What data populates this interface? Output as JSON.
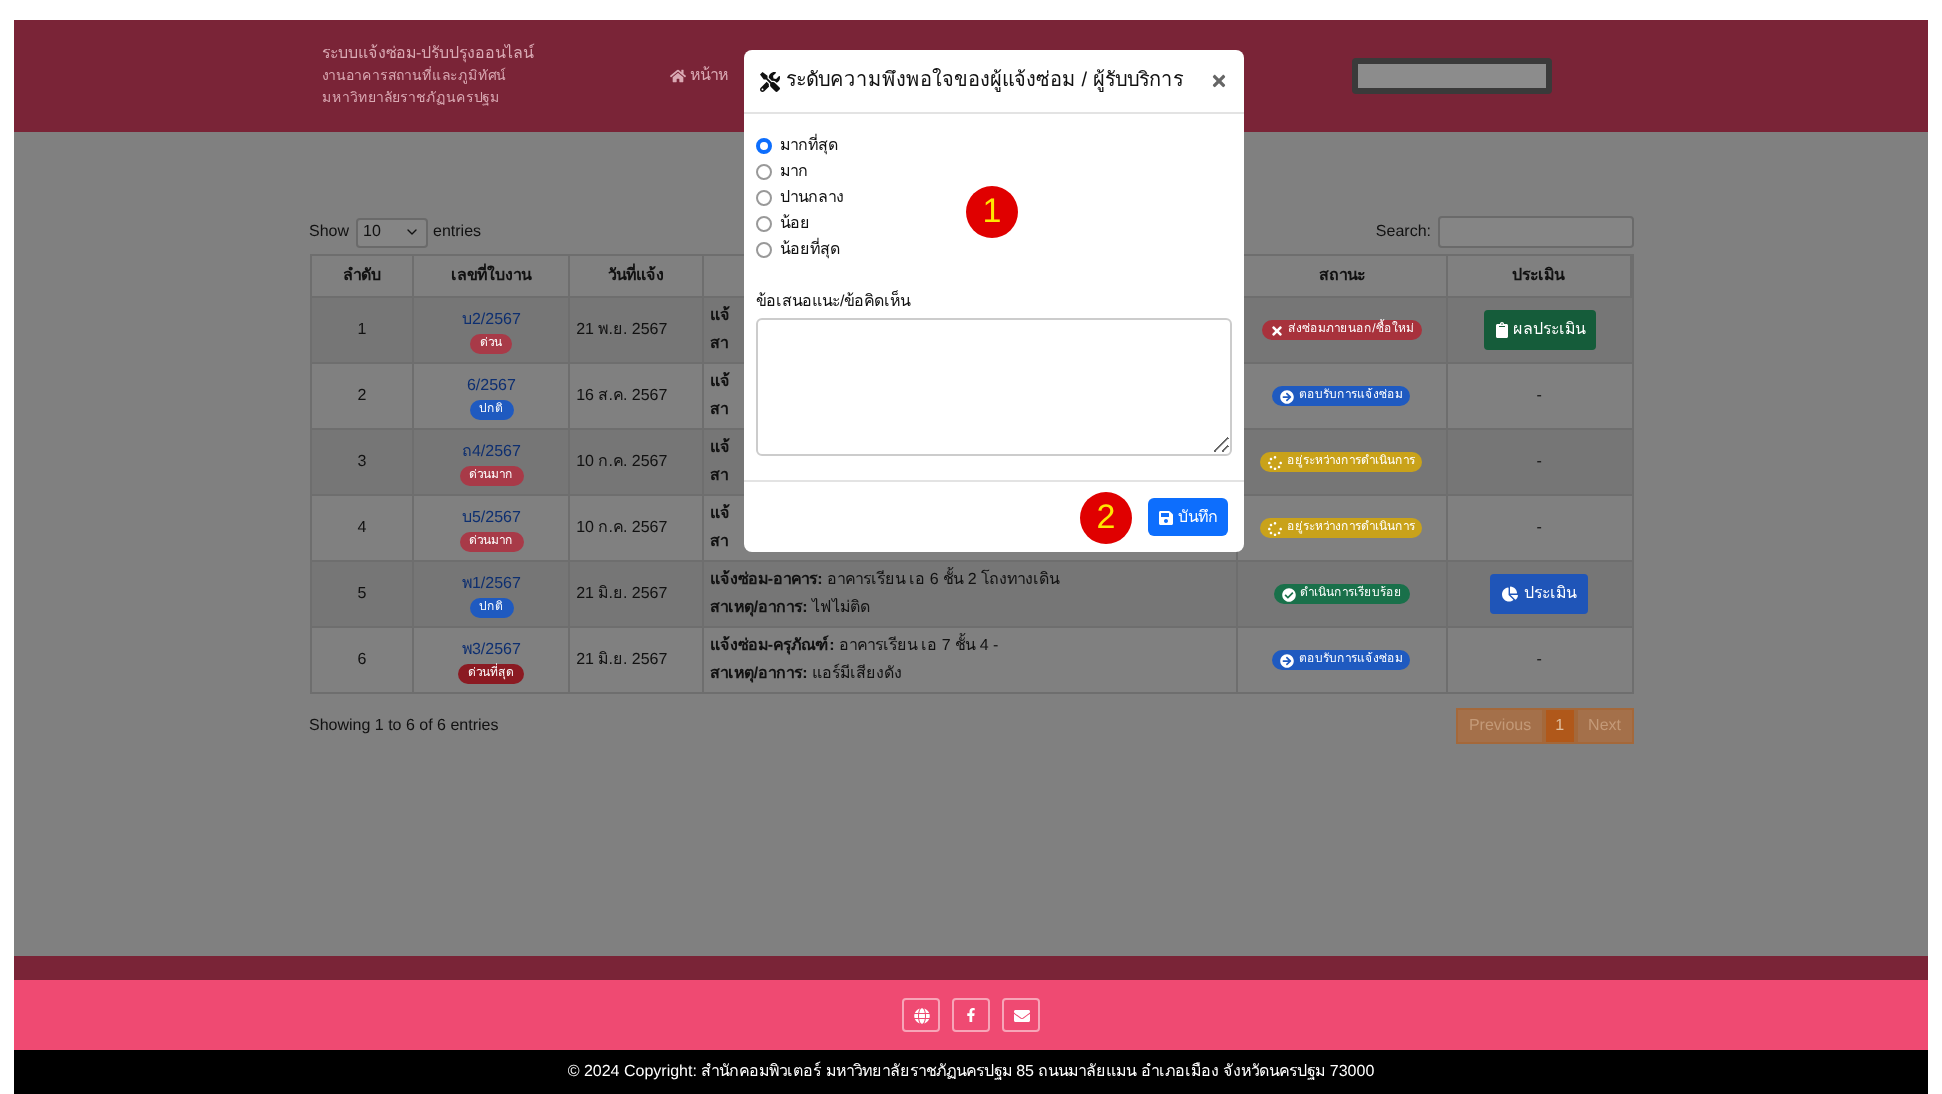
{
  "header": {
    "title_lines": [
      "ระบบแจ้งซ่อม-ปรับปรุงออนไลน์",
      "งานอาคารสถานที่และภูมิทัศน์",
      "มหาวิทยาลัยราชภัฏนครปฐม"
    ],
    "nav_label": "หน้าห"
  },
  "table_controls": {
    "show_label": "Show",
    "page_length": "10",
    "entries_label": "entries",
    "search_label": "Search:"
  },
  "table": {
    "columns": [
      "ลำดับ",
      "เลขที่ใบงาน",
      "วันที่แจ้ง",
      "",
      "สถานะ",
      "ประเมิน"
    ],
    "rows": [
      {
        "number": "1",
        "job_no": "บ2/2567",
        "urgency": {
          "label": "ด่วน",
          "color": "#a83a48"
        },
        "date": "21 พ.ย. 2567",
        "detail": [
          {
            "label": "แจ้"
          },
          {
            "label": "สา"
          }
        ],
        "status": {
          "label": "ส่งซ่อมภายนอก/ซื้อใหม่",
          "color": "#a8323c",
          "kind": "x"
        },
        "evaluation": {
          "kind": "result",
          "label": "ผลประเมิน"
        }
      },
      {
        "number": "2",
        "job_no": "6/2567",
        "urgency": {
          "label": "ปกติ",
          "color": "#1f5ac0"
        },
        "date": "16 ส.ค. 2567",
        "detail": [
          {
            "label": "แจ้"
          },
          {
            "label": "สา"
          }
        ],
        "status": {
          "label": "ตอบรับการแจ้งซ่อม",
          "color": "#1f5ac0",
          "kind": "arrow"
        },
        "evaluation": {
          "kind": "none",
          "label": "-"
        }
      },
      {
        "number": "3",
        "job_no": "ถ4/2567",
        "urgency": {
          "label": "ด่วนมาก",
          "color": "#a83a48"
        },
        "date": "10 ก.ค. 2567",
        "detail": [
          {
            "label": "แจ้"
          },
          {
            "label": "สา"
          }
        ],
        "status": {
          "label": "อยู่ระหว่างการดำเนินการ",
          "color": "#c9a21a",
          "kind": "spin"
        },
        "evaluation": {
          "kind": "none",
          "label": "-"
        }
      },
      {
        "number": "4",
        "job_no": "บ5/2567",
        "urgency": {
          "label": "ด่วนมาก",
          "color": "#a83a48"
        },
        "date": "10 ก.ค. 2567",
        "detail": [
          {
            "label": "แจ้"
          },
          {
            "label": "สา"
          }
        ],
        "status": {
          "label": "อยู่ระหว่างการดำเนินการ",
          "color": "#c9a21a",
          "kind": "spin"
        },
        "evaluation": {
          "kind": "none",
          "label": "-"
        }
      },
      {
        "number": "5",
        "job_no": "พ1/2567",
        "urgency": {
          "label": "ปกติ",
          "color": "#1f5ac0"
        },
        "date": "21 มิ.ย. 2567",
        "detail": [
          {
            "label": "แจ้งซ่อม-อาคาร:",
            "text": "อาคารเรียน เอ 6 ชั้น 2 โถงทางเดิน"
          },
          {
            "label": "สาเหตุ/อาการ:",
            "text": "ไฟไม่ติด"
          }
        ],
        "status": {
          "label": "ดำเนินการเรียบร้อย",
          "color": "#19704a",
          "kind": "check"
        },
        "evaluation": {
          "kind": "evaluate",
          "label": "ประเมิน"
        }
      },
      {
        "number": "6",
        "job_no": "พ3/2567",
        "urgency": {
          "label": "ด่วนที่สุด",
          "color": "#8b1a22"
        },
        "date": "21 มิ.ย. 2567",
        "detail": [
          {
            "label": "แจ้งซ่อม-ครุภัณฑ์:",
            "text": "อาคารเรียน เอ 7 ชั้น 4 -"
          },
          {
            "label": "สาเหตุ/อาการ:",
            "text": "แอร์มีเสียงดัง"
          }
        ],
        "status": {
          "label": "ตอบรับการแจ้งซ่อม",
          "color": "#1f5ac0",
          "kind": "arrow"
        },
        "evaluation": {
          "kind": "none",
          "label": "-"
        }
      }
    ]
  },
  "table_info": "Showing 1 to 6 of 6 entries",
  "pagination": [
    {
      "label": "Previous",
      "selected": false,
      "disabled": true
    },
    {
      "label": "1",
      "selected": true,
      "disabled": false
    },
    {
      "label": "Next",
      "selected": false,
      "disabled": true
    }
  ],
  "modal": {
    "title": "ระดับความพึงพอใจของผู้แจ้งซ่อม / ผู้รับบริการ",
    "options": [
      {
        "label": "มากที่สุด",
        "selected": true
      },
      {
        "label": "มาก",
        "selected": false
      },
      {
        "label": "ปานกลาง",
        "selected": false
      },
      {
        "label": "น้อย",
        "selected": false
      },
      {
        "label": "น้อยที่สุด",
        "selected": false
      }
    ],
    "comment_label": "ข้อเสนอแนะ/ข้อคิดเห็น",
    "save_label": "บันทึก",
    "markers": [
      "1",
      "2"
    ]
  },
  "footer": {
    "copyright": "© 2024 Copyright: สำนักคอมพิวเตอร์ มหาวิทยาลัยราชภัฏนครปฐม 85 ถนนมาลัยแมน อำเภอเมือง จังหวัดนครปฐม 73000"
  }
}
